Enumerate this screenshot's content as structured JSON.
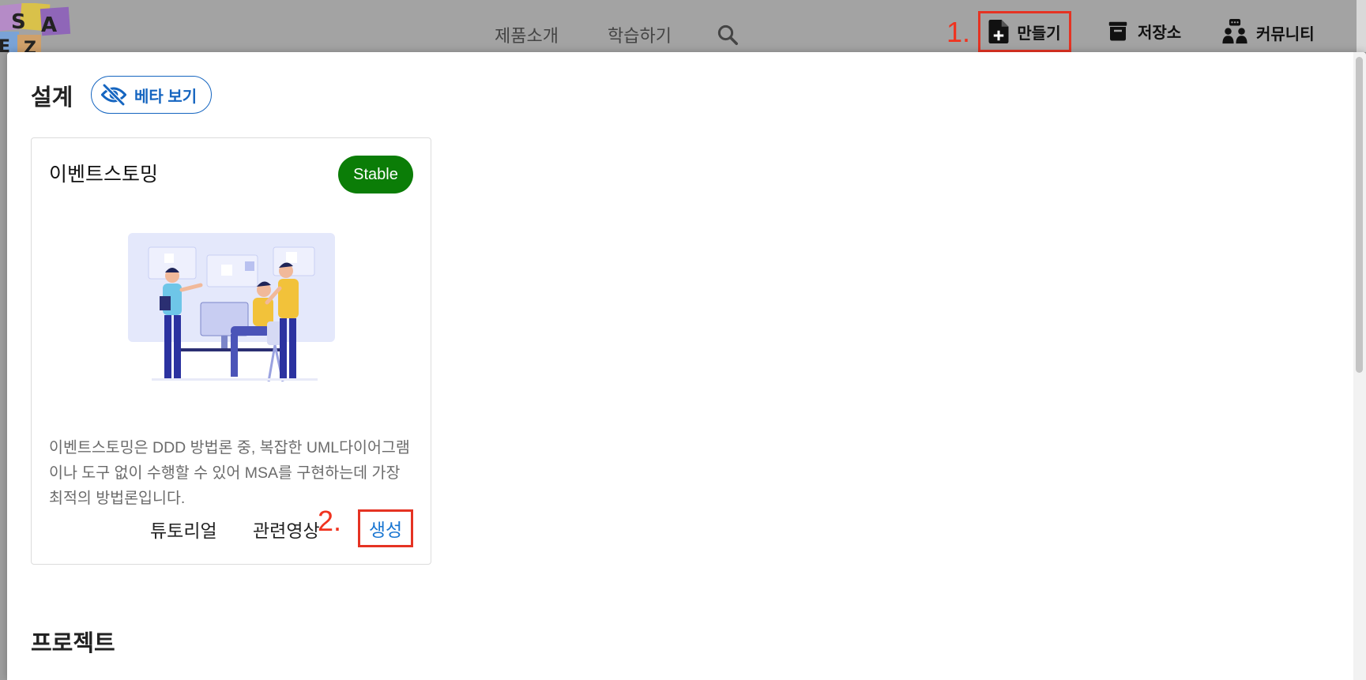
{
  "topbar": {
    "logo_letters": [
      "S",
      "A",
      "E",
      "Z"
    ],
    "nav_links": [
      "제품소개",
      "학습하기"
    ],
    "search_icon": "search-icon",
    "create_label": "만들기",
    "storage_label": "저장소",
    "community_label": "커뮤니티",
    "annotation_1": "1."
  },
  "panel": {
    "design_title": "설계",
    "beta_label": "베타 보기",
    "card": {
      "title": "이벤트스토밍",
      "badge": "Stable",
      "badge_color": "#0b7d07",
      "description": "이벤트스토밍은 DDD 방법론 중, 복잡한 UML다이어그램이나 도구 없이 수행할 수 있어 MSA를 구현하는데 가장 최적의 방법론입니다.",
      "actions": {
        "tutorial": "튜토리얼",
        "related_video": "관련영상",
        "create": "생성"
      },
      "annotation_2": "2."
    },
    "project_title": "프로젝트"
  },
  "colors": {
    "accent": "#1565c0",
    "annotation": "#e53323",
    "link": "#1976d2"
  }
}
